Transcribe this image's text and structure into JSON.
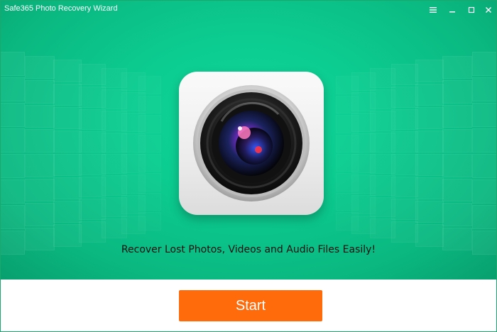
{
  "window": {
    "title": "Safe365 Photo Recovery Wizard",
    "controls": {
      "menu_icon": "menu-icon",
      "minimize_icon": "minimize-icon",
      "maximize_icon": "maximize-icon",
      "close_icon": "close-icon"
    }
  },
  "hero": {
    "icon": "camera-lens-icon",
    "tagline": "Recover Lost Photos, Videos and Audio Files Easily!"
  },
  "footer": {
    "start_label": "Start"
  },
  "colors": {
    "accent_green": "#0ccc90",
    "start_orange": "#ff6a0a",
    "window_border": "#1aa86f"
  }
}
